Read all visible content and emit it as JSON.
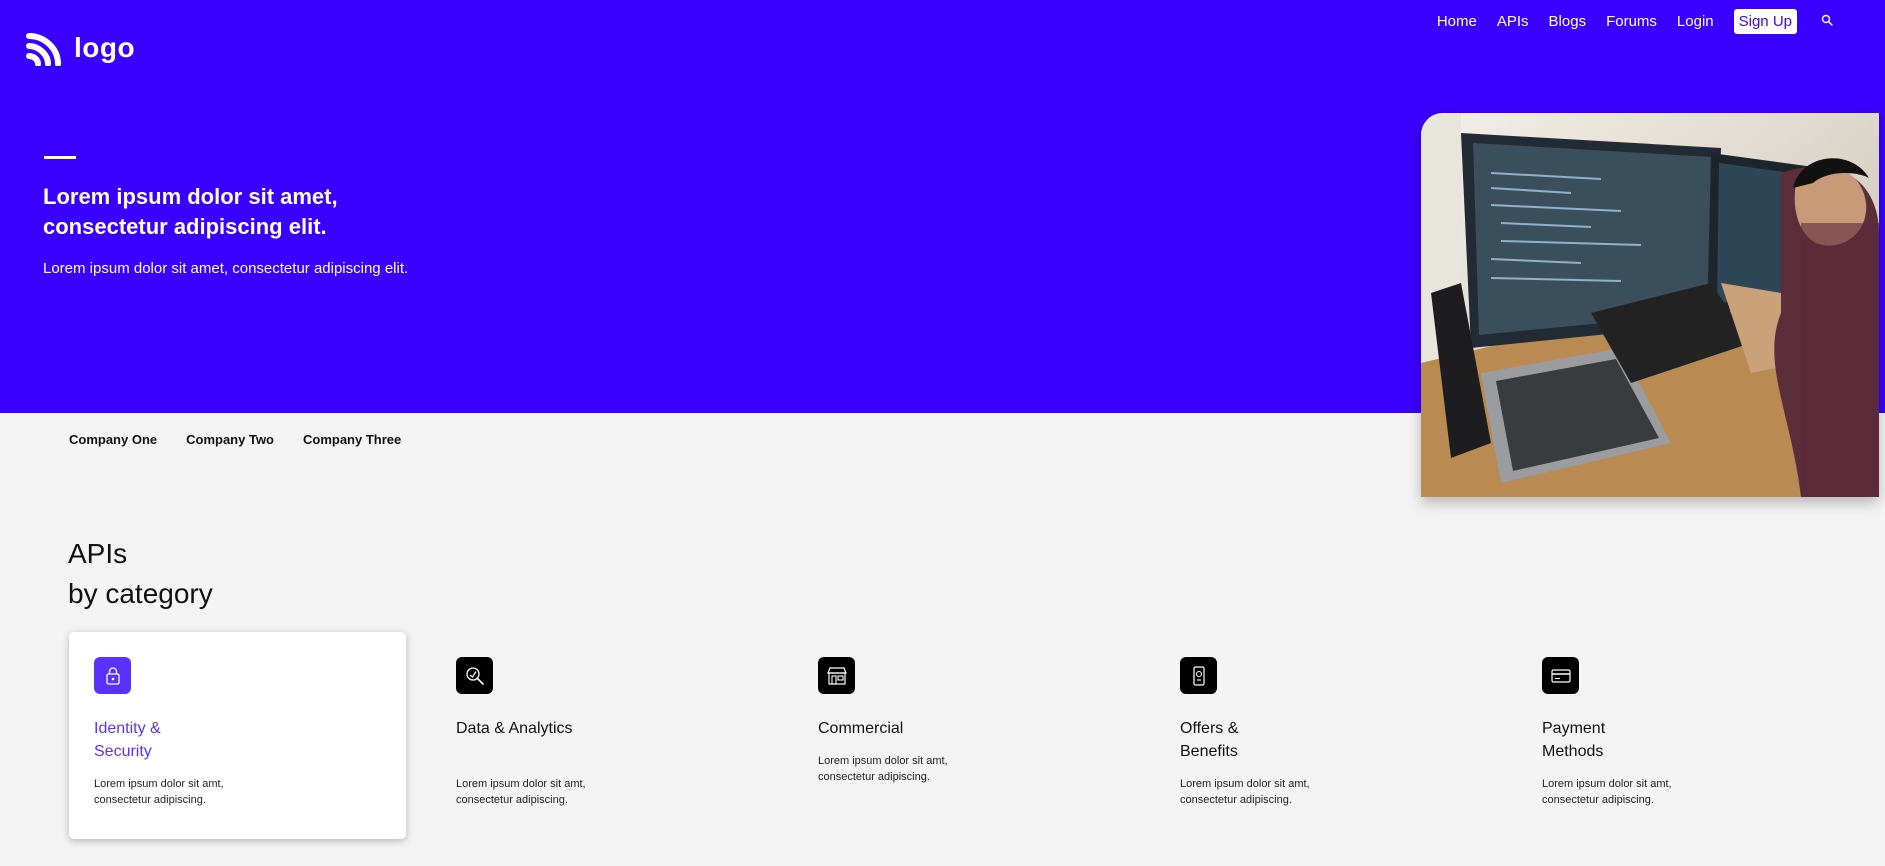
{
  "header": {
    "logo_text": "logo",
    "nav": [
      "Home",
      "APIs",
      "Blogs",
      "Forums",
      "Login"
    ],
    "signup_label": "Sign Up",
    "search_icon": "search-icon"
  },
  "hero": {
    "title": "Lorem ipsum dolor sit amet, consectetur adipiscing elit.",
    "subtitle": "Lorem ipsum dolor sit amet, consectetur adipiscing elit.",
    "image": "developer-at-computers-photo"
  },
  "partners": [
    "Company One",
    "Company Two",
    "Company Three"
  ],
  "apis": {
    "title_line1": "APIs",
    "title_line2": "by category",
    "categories": [
      {
        "title": "Identity & Security",
        "desc": "Lorem ipsum dolor sit amt, consectetur adipiscing.",
        "icon": "lock-icon",
        "active": true
      },
      {
        "title": "Data & Analytics",
        "desc": "Lorem ipsum dolor sit amt, consectetur adipiscing.",
        "icon": "magnifier-chart-icon",
        "active": false
      },
      {
        "title": "Commercial",
        "desc": "Lorem ipsum dolor sit amt, consectetur adipiscing.",
        "icon": "storefront-icon",
        "active": false
      },
      {
        "title": "Offers & Benefits",
        "desc": "Lorem ipsum dolor sit amt, consectetur adipiscing.",
        "icon": "mobile-offer-icon",
        "active": false
      },
      {
        "title": "Payment Methods",
        "desc": "Lorem ipsum dolor sit amt, consectetur adipiscing.",
        "icon": "credit-card-icon",
        "active": false
      }
    ]
  },
  "colors": {
    "brand": "#3a00ff",
    "accent": "#5a32ff",
    "background": "#f4f4f4"
  }
}
